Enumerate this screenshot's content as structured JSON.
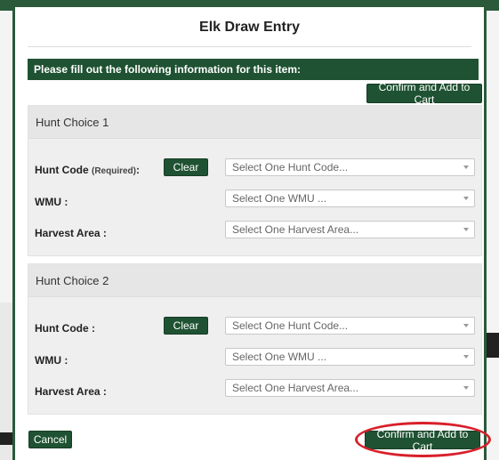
{
  "modal": {
    "title": "Elk Draw Entry",
    "instruction": "Please fill out the following information for this item:",
    "confirm_label": "Confirm and Add to Cart",
    "cancel_label": "Cancel"
  },
  "choices": [
    {
      "header": "Hunt Choice 1",
      "hunt_code_label": "Hunt Code",
      "hunt_code_required": "(Required)",
      "hunt_code_colon": ":",
      "clear_label": "Clear",
      "hunt_code_placeholder": "Select One Hunt Code...",
      "wmu_label": "WMU :",
      "wmu_placeholder": "Select One WMU ...",
      "harvest_label": "Harvest Area :",
      "harvest_placeholder": "Select One Harvest Area..."
    },
    {
      "header": "Hunt Choice 2",
      "hunt_code_label": "Hunt Code :",
      "clear_label": "Clear",
      "hunt_code_placeholder": "Select One Hunt Code...",
      "wmu_label": "WMU :",
      "wmu_placeholder": "Select One WMU ...",
      "harvest_label": "Harvest Area :",
      "harvest_placeholder": "Select One Harvest Area..."
    }
  ],
  "colors": {
    "brand_green": "#1f5232",
    "highlight_red": "#d8202a"
  }
}
